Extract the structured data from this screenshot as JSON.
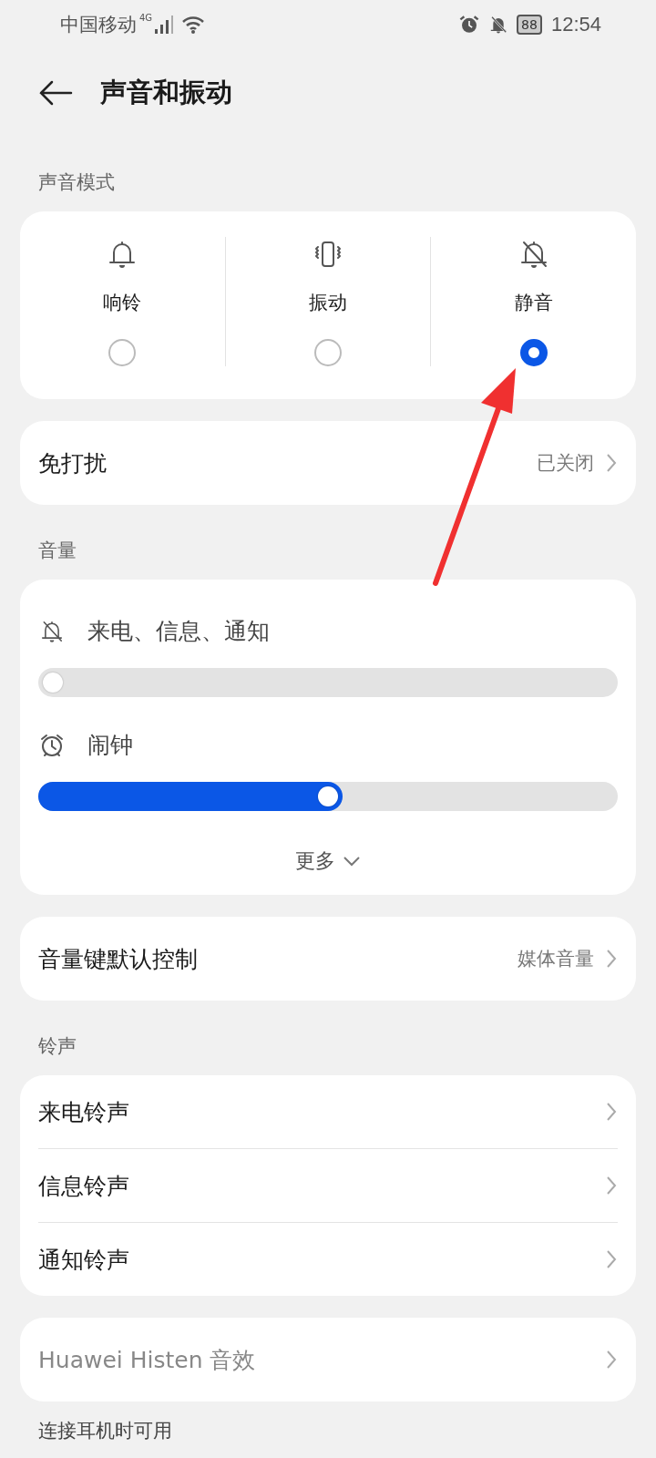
{
  "status_bar": {
    "carrier": "中国移动",
    "network": "4G",
    "battery": "88",
    "time": "12:54"
  },
  "header": {
    "title": "声音和振动"
  },
  "sound_mode": {
    "heading": "声音模式",
    "options": [
      {
        "kind": "bell",
        "label": "响铃",
        "selected": false
      },
      {
        "kind": "vibrate",
        "label": "振动",
        "selected": false
      },
      {
        "kind": "mute",
        "label": "静音",
        "selected": true
      }
    ]
  },
  "do_not_disturb": {
    "label": "免打扰",
    "value": "已关闭"
  },
  "volume": {
    "heading": "音量",
    "sliders": [
      {
        "kind": "mute",
        "label": "来电、信息、通知",
        "level": 0
      },
      {
        "kind": "alarm",
        "label": "闹钟",
        "level": 0.5
      }
    ],
    "more": "更多"
  },
  "volume_key": {
    "label": "音量键默认控制",
    "value": "媒体音量"
  },
  "ringtones": {
    "heading": "铃声",
    "items": [
      {
        "label": "来电铃声",
        "disabled": false
      },
      {
        "label": "信息铃声",
        "disabled": false
      },
      {
        "label": "通知铃声",
        "disabled": false
      }
    ]
  },
  "histen": {
    "label": "Huawei Histen 音效",
    "disabled": true
  },
  "headset_heading": "连接耳机时可用"
}
